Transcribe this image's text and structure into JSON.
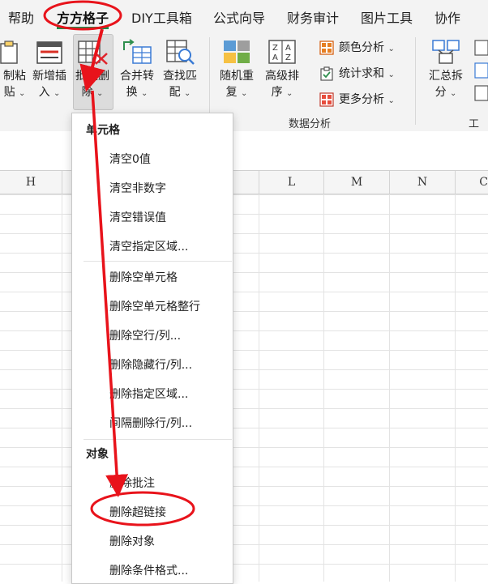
{
  "tabs": [
    {
      "label": "帮助",
      "active": false
    },
    {
      "label": "方方格子",
      "active": true
    },
    {
      "label": "DIY工具箱",
      "active": false
    },
    {
      "label": "公式向导",
      "active": false
    },
    {
      "label": "财务审计",
      "active": false
    },
    {
      "label": "图片工具",
      "active": false
    },
    {
      "label": "协作",
      "active": false
    }
  ],
  "ribbon": {
    "btn_paste": {
      "line1": "制粘",
      "line2": "贴",
      "chev": "⌄"
    },
    "btn_insert": {
      "line1": "新增插",
      "line2": "入",
      "chev": "⌄"
    },
    "btn_batch_delete": {
      "line1": "批量删",
      "line2": "除",
      "chev": "⌄"
    },
    "btn_merge_convert": {
      "line1": "合并转",
      "line2": "换",
      "chev": "⌄"
    },
    "btn_find_match": {
      "line1": "查找匹",
      "line2": "配",
      "chev": "⌄"
    },
    "btn_random_repeat": {
      "line1": "随机重",
      "line2": "复",
      "chev": "⌄"
    },
    "btn_advanced_sort": {
      "line1": "高级排",
      "line2": "序",
      "chev": "⌄"
    },
    "btn_color_analysis": {
      "label": "颜色分析",
      "chev": "⌄"
    },
    "btn_stat_sum": {
      "label": "统计求和",
      "chev": "⌄"
    },
    "btn_more_analysis": {
      "label": "更多分析",
      "chev": "⌄"
    },
    "btn_summary_split": {
      "line1": "汇总拆",
      "line2": "分",
      "chev": "⌄"
    },
    "group_data_analysis": "数据分析",
    "group_work_partial": "工作"
  },
  "columns": [
    "H",
    "",
    "",
    "",
    "L",
    "M",
    "N",
    "C"
  ],
  "menu": {
    "section_cells": "单元格",
    "cells_items": [
      "清空0值",
      "清空非数字",
      "清空错误值",
      "清空指定区域..."
    ],
    "delete_items": [
      "删除空单元格",
      "删除空单元格整行",
      "删除空行/列...",
      "删除隐藏行/列...",
      "删除指定区域...",
      "间隔删除行/列..."
    ],
    "section_objects": "对象",
    "object_items": [
      "删除批注",
      "删除超链接",
      "删除对象",
      "删除条件格式..."
    ]
  },
  "colors": {
    "accent_green": "#1a8f4e",
    "annotation_red": "#e8131b",
    "ribbon_bg": "#f3f3f3"
  },
  "icons": [
    "paste-icon",
    "insert-icon",
    "batch-delete-icon",
    "merge-convert-icon",
    "find-match-icon",
    "random-repeat-icon",
    "advanced-sort-icon",
    "color-analysis-icon",
    "stat-sum-icon",
    "more-analysis-icon",
    "summary-split-icon"
  ]
}
